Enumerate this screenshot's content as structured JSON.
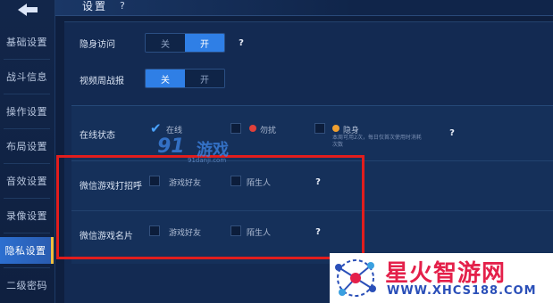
{
  "header": {
    "title": "设置",
    "help": "?"
  },
  "sidebar": {
    "items": [
      {
        "label": "基础设置",
        "active": false
      },
      {
        "label": "战斗信息",
        "active": false
      },
      {
        "label": "操作设置",
        "active": false
      },
      {
        "label": "布局设置",
        "active": false
      },
      {
        "label": "音效设置",
        "active": false
      },
      {
        "label": "录像设置",
        "active": false
      },
      {
        "label": "隐私设置",
        "active": true
      },
      {
        "label": "二级密码",
        "active": false
      }
    ]
  },
  "settings": {
    "stealth": {
      "label": "隐身访问",
      "off": "关",
      "on": "开",
      "selected": "on",
      "help": "?"
    },
    "weekly_report": {
      "label": "视频周战报",
      "off": "关",
      "on": "开",
      "selected": "off"
    },
    "online_status": {
      "label": "在线状态",
      "options": [
        {
          "label": "在线",
          "checked": true
        },
        {
          "label": "勿扰",
          "checked": false
        },
        {
          "label": "隐身",
          "checked": false
        }
      ],
      "hint": "本周可用2次，每日仅首次使用时消耗次数",
      "help": "?"
    },
    "wechat_greeting": {
      "label": "微信游戏打招呼",
      "options": [
        {
          "label": "游戏好友",
          "checked": false
        },
        {
          "label": "陌生人",
          "checked": false
        }
      ],
      "help": "?"
    },
    "wechat_card": {
      "label": "微信游戏名片",
      "options": [
        {
          "label": "游戏好友",
          "checked": false
        },
        {
          "label": "陌生人",
          "checked": false
        }
      ],
      "help": "?"
    }
  },
  "watermark_91": {
    "big": "91",
    "cn": "游戏",
    "url": "91danji.com"
  },
  "logo": {
    "cn": "星火智游网",
    "url": "WWW.XHCS188.COM"
  },
  "colors": {
    "accent": "#2f7fe6",
    "highlight": "#e11d1d",
    "dnd": "#e0403a",
    "invisible": "#f0a030"
  }
}
